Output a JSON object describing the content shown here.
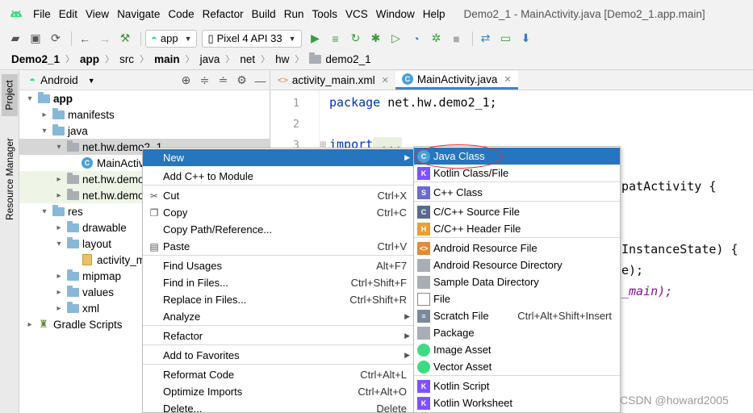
{
  "menubar": {
    "items": [
      "File",
      "Edit",
      "View",
      "Navigate",
      "Code",
      "Refactor",
      "Build",
      "Run",
      "Tools",
      "VCS",
      "Window",
      "Help"
    ],
    "window_title": "Demo2_1 - MainActivity.java [Demo2_1.app.main]"
  },
  "toolbar": {
    "module_combo": "app",
    "device_combo": "Pixel 4 API 33"
  },
  "breadcrumb": [
    "Demo2_1",
    "app",
    "src",
    "main",
    "java",
    "net",
    "hw",
    "demo2_1"
  ],
  "left_strip": {
    "project_tab": "Project",
    "resource_manager_tab": "Resource Manager"
  },
  "project": {
    "view_selector": "Android",
    "tree": [
      {
        "label": "app",
        "depth": 0,
        "expanded": true,
        "icon": "folder-icon"
      },
      {
        "label": "manifests",
        "depth": 1,
        "expanded": false,
        "icon": "folder-icon"
      },
      {
        "label": "java",
        "depth": 1,
        "expanded": true,
        "icon": "folder-icon"
      },
      {
        "label": "net.hw.demo2_1",
        "depth": 2,
        "expanded": true,
        "icon": "package-icon"
      },
      {
        "label": "MainActivity",
        "depth": 3,
        "icon": "class-icon"
      },
      {
        "label": "net.hw.demo2_1",
        "depth": 2,
        "expanded": false,
        "icon": "package-icon"
      },
      {
        "label": "net.hw.demo2_1",
        "depth": 2,
        "expanded": false,
        "icon": "package-icon"
      },
      {
        "label": "res",
        "depth": 1,
        "expanded": true,
        "icon": "folder-icon"
      },
      {
        "label": "drawable",
        "depth": 2,
        "expanded": false,
        "icon": "folder-icon"
      },
      {
        "label": "layout",
        "depth": 2,
        "expanded": true,
        "icon": "folder-icon"
      },
      {
        "label": "activity_main.xml",
        "depth": 3,
        "icon": "layout-file-icon"
      },
      {
        "label": "mipmap",
        "depth": 2,
        "expanded": false,
        "icon": "folder-icon"
      },
      {
        "label": "values",
        "depth": 2,
        "expanded": false,
        "icon": "folder-icon"
      },
      {
        "label": "xml",
        "depth": 2,
        "expanded": false,
        "icon": "folder-icon"
      },
      {
        "label": "Gradle Scripts",
        "depth": 0,
        "expanded": false,
        "icon": "gradle-icon"
      }
    ]
  },
  "editor": {
    "tabs": [
      {
        "label": "activity_main.xml",
        "active": false
      },
      {
        "label": "MainActivity.java",
        "active": true
      }
    ],
    "line_numbers": [
      "1",
      "2",
      "3"
    ],
    "code_line1_kw": "package",
    "code_line1_rest": " net.hw.demo2_1;",
    "code_line3_kw": "import",
    "code_line3_rest": " ...",
    "frag1": "patActivity {",
    "frag2": "InstanceState) {",
    "frag3": "e);",
    "frag4": "_main);"
  },
  "context_menu": {
    "items": [
      {
        "label": "New",
        "submenu": true,
        "highlighted": true
      },
      {
        "label": "Add C++ to Module"
      },
      {
        "label": "Cut",
        "shortcut": "Ctrl+X",
        "icon": "cut-icon"
      },
      {
        "label": "Copy",
        "shortcut": "Ctrl+C",
        "icon": "copy-icon"
      },
      {
        "label": "Copy Path/Reference..."
      },
      {
        "label": "Paste",
        "shortcut": "Ctrl+V",
        "icon": "paste-icon"
      },
      {
        "label": "Find Usages",
        "shortcut": "Alt+F7"
      },
      {
        "label": "Find in Files...",
        "shortcut": "Ctrl+Shift+F"
      },
      {
        "label": "Replace in Files...",
        "shortcut": "Ctrl+Shift+R"
      },
      {
        "label": "Analyze",
        "submenu": true
      },
      {
        "label": "Refactor",
        "submenu": true
      },
      {
        "label": "Add to Favorites",
        "submenu": true
      },
      {
        "label": "Reformat Code",
        "shortcut": "Ctrl+Alt+L"
      },
      {
        "label": "Optimize Imports",
        "shortcut": "Ctrl+Alt+O"
      },
      {
        "label": "Delete...",
        "shortcut": "Delete"
      }
    ]
  },
  "new_submenu": {
    "items": [
      {
        "label": "Java Class",
        "highlighted": true,
        "icon": "java-class-icon"
      },
      {
        "label": "Kotlin Class/File",
        "icon": "kotlin-icon"
      },
      {
        "label": "C++ Class",
        "icon": "cpp-class-icon"
      },
      {
        "label": "C/C++ Source File",
        "icon": "cpp-source-icon"
      },
      {
        "label": "C/C++ Header File",
        "icon": "cpp-header-icon"
      },
      {
        "label": "Android Resource File",
        "icon": "android-resource-file-icon"
      },
      {
        "label": "Android Resource Directory",
        "icon": "folder-icon"
      },
      {
        "label": "Sample Data Directory",
        "icon": "folder-icon"
      },
      {
        "label": "File",
        "icon": "file-icon"
      },
      {
        "label": "Scratch File",
        "shortcut": "Ctrl+Alt+Shift+Insert",
        "icon": "scratch-file-icon"
      },
      {
        "label": "Package",
        "icon": "package-icon"
      },
      {
        "label": "Image Asset",
        "icon": "android-icon"
      },
      {
        "label": "Vector Asset",
        "icon": "android-icon"
      },
      {
        "label": "Kotlin Script",
        "icon": "kotlin-icon"
      },
      {
        "label": "Kotlin Worksheet",
        "icon": "kotlin-icon"
      }
    ]
  },
  "watermark": "CSDN @howard2005",
  "colors": {
    "highlight": "#2675bf",
    "annotation_circle": "#e23030",
    "android_green": "#3ddc84"
  }
}
